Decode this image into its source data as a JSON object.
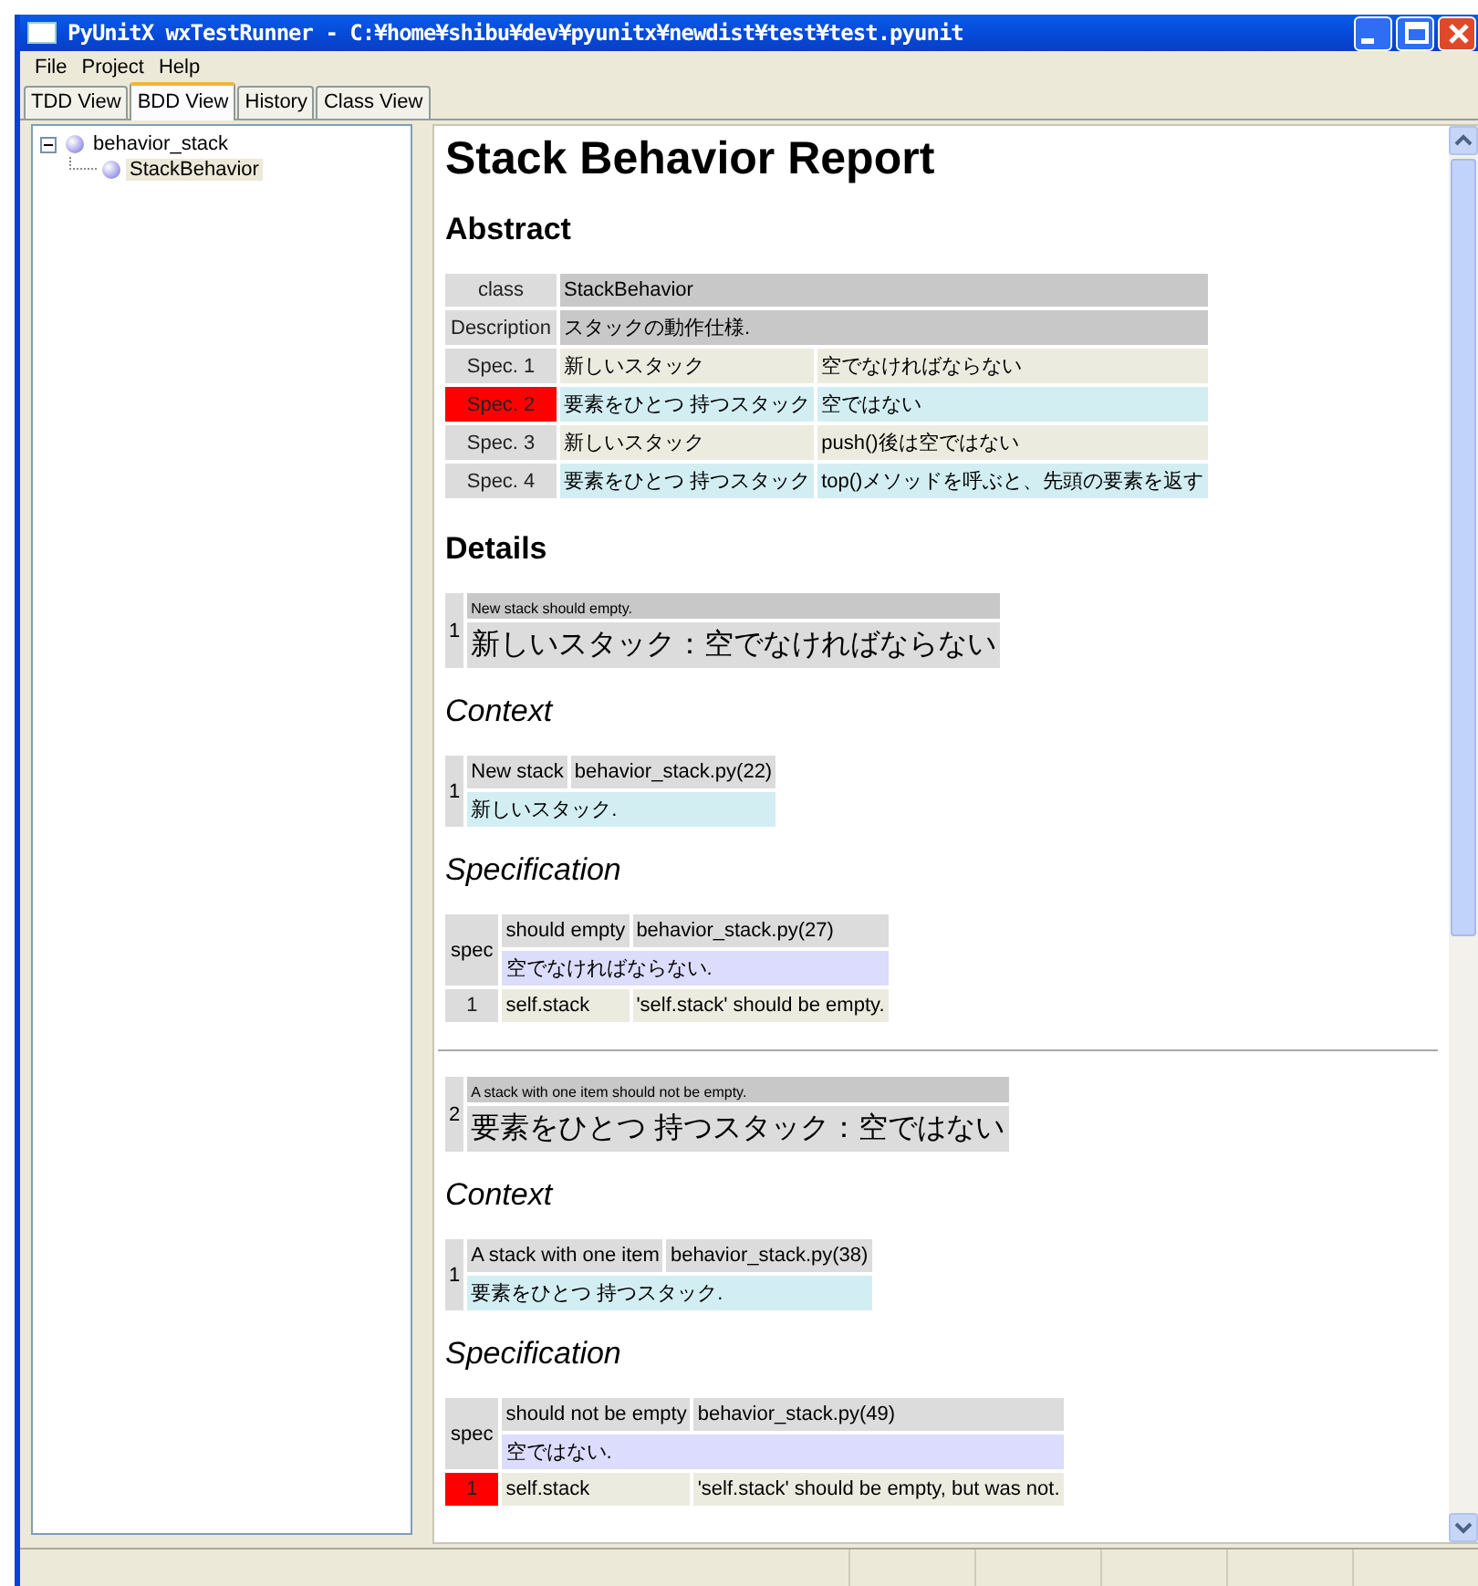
{
  "window": {
    "title": "PyUnitX wxTestRunner - C:¥home¥shibu¥dev¥pyunitx¥newdist¥test¥test.pyunit"
  },
  "menu": [
    "File",
    "Project",
    "Help"
  ],
  "tabs": [
    {
      "label": "TDD View",
      "selected": false
    },
    {
      "label": "BDD View",
      "selected": true
    },
    {
      "label": "History",
      "selected": false
    },
    {
      "label": "Class View",
      "selected": false
    }
  ],
  "tree": [
    {
      "label": "behavior_stack",
      "selected": false,
      "expanded": true,
      "children": [
        {
          "label": "StackBehavior",
          "selected": true
        }
      ]
    }
  ],
  "report": {
    "title": "Stack Behavior Report",
    "abstract_heading": "Abstract",
    "abstract": {
      "class_label": "class",
      "class_value": "StackBehavior",
      "description_label": "Description",
      "description_value": "スタックの動作仕様.",
      "specs": [
        {
          "label": "Spec. 1",
          "failed": false,
          "context": "新しいスタック",
          "spec": "空でなければならない"
        },
        {
          "label": "Spec. 2",
          "failed": true,
          "context": "要素をひとつ 持つスタック",
          "spec": "空ではない"
        },
        {
          "label": "Spec. 3",
          "failed": false,
          "context": "新しいスタック",
          "spec": "push()後は空ではない"
        },
        {
          "label": "Spec. 4",
          "failed": false,
          "context": "要素をひとつ 持つスタック",
          "spec": "top()メソッドを呼ぶと、先頭の要素を返す"
        }
      ]
    },
    "details_heading": "Details",
    "details": [
      {
        "number": "1",
        "summary": "New stack should empty.",
        "title": "新しいスタック：空でなければならない",
        "context_heading": "Context",
        "context": {
          "number": "1",
          "name": "New stack",
          "location": "behavior_stack.py(22)",
          "description": "新しいスタック."
        },
        "spec_heading": "Specification",
        "spec": {
          "label": "spec",
          "name": "should empty",
          "location": "behavior_stack.py(27)",
          "description": "空でなければならない.",
          "results": [
            {
              "number": "1",
              "failed": false,
              "subject": "self.stack",
              "message": "'self.stack' should be empty."
            }
          ]
        }
      },
      {
        "number": "2",
        "summary": "A stack with one item should not be empty.",
        "title": "要素をひとつ 持つスタック：空ではない",
        "context_heading": "Context",
        "context": {
          "number": "1",
          "name": "A stack with one item",
          "location": "behavior_stack.py(38)",
          "description": "要素をひとつ 持つスタック."
        },
        "spec_heading": "Specification",
        "spec": {
          "label": "spec",
          "name": "should not be empty",
          "location": "behavior_stack.py(49)",
          "description": "空ではない.",
          "results": [
            {
              "number": "1",
              "failed": true,
              "subject": "self.stack",
              "message": "'self.stack' should be empty, but was not."
            }
          ]
        }
      }
    ]
  }
}
